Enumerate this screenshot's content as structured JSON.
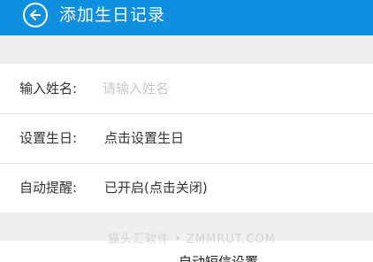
{
  "header": {
    "back_icon": "back-arrow-circle-icon",
    "title": "添加生日记录",
    "color": "#0e8fdf"
  },
  "form": {
    "name": {
      "label": "输入姓名:",
      "placeholder": "请输入姓名",
      "value": ""
    },
    "birthday": {
      "label": "设置生日:",
      "value": "点击设置生日"
    },
    "reminder": {
      "label": "自动提醒:",
      "value": "已开启(点击关闭)"
    }
  },
  "watermark": "猫头汇软件 • ZMMRUT.COM",
  "bottom": {
    "sms_settings_label": "自动短信设置"
  }
}
